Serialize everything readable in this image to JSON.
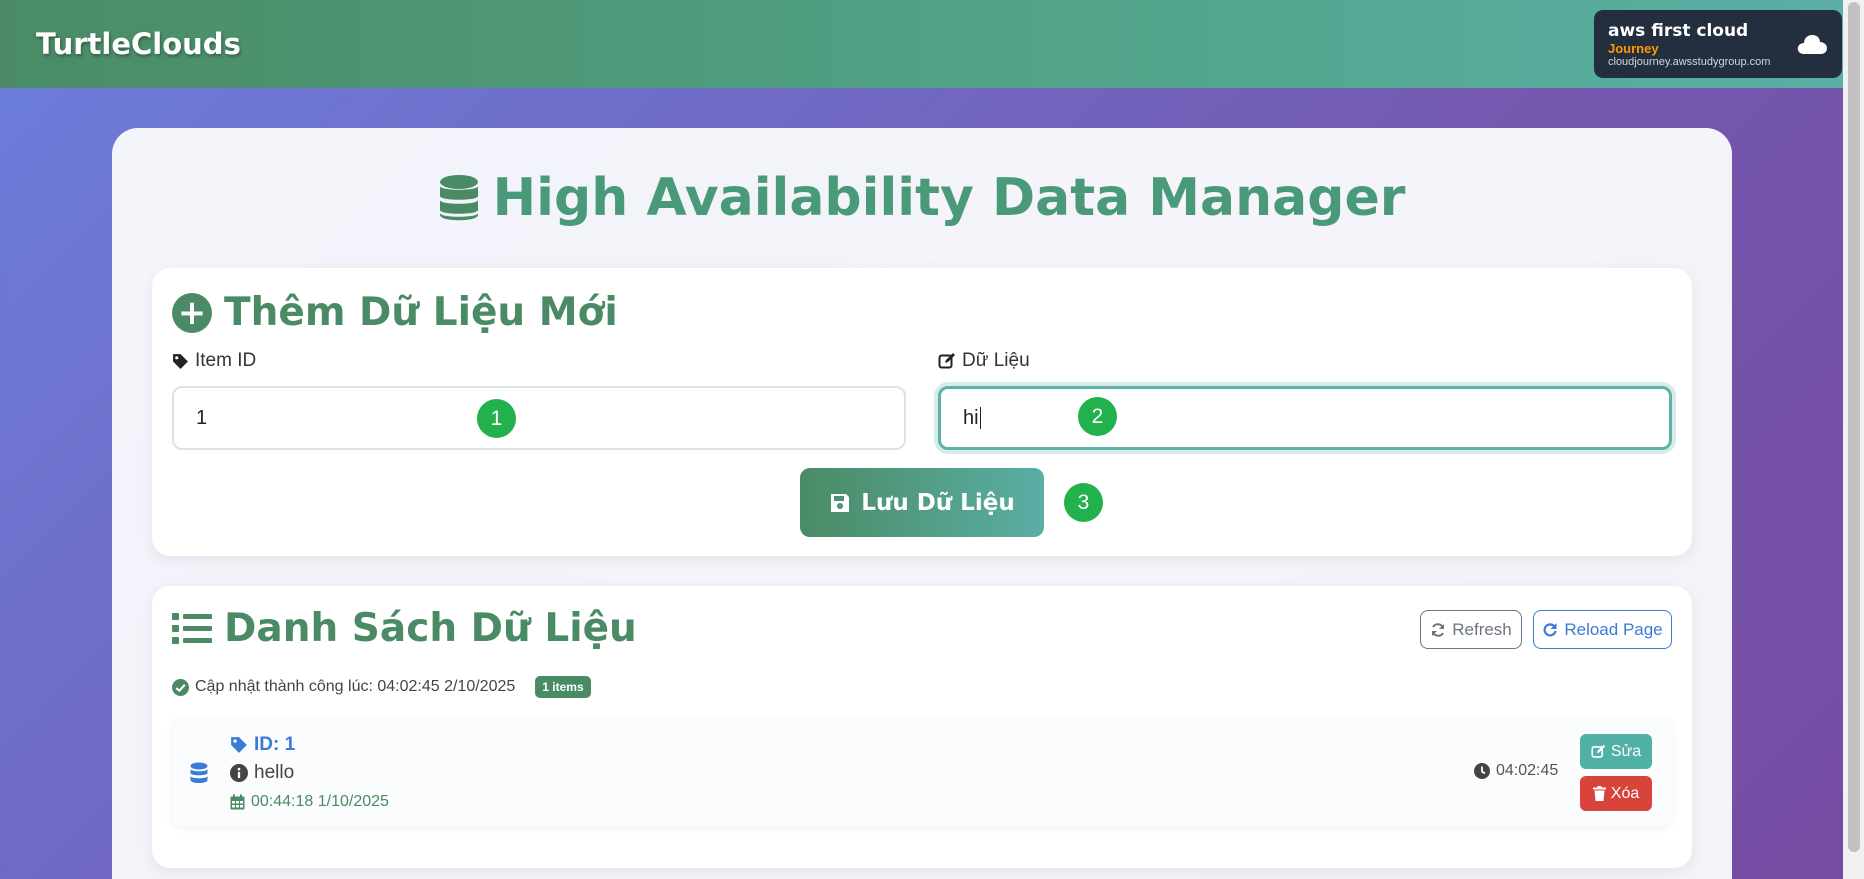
{
  "navbar": {
    "brand": "TurtleClouds",
    "badge": {
      "title": "aws first cloud",
      "subtitle": "Journey",
      "url": "cloudjourney.awsstudygroup.com",
      "icon": "cloud-icon"
    }
  },
  "page": {
    "title": "High Availability Data Manager",
    "title_icon": "database-icon"
  },
  "add_section": {
    "title": "Thêm Dữ Liệu Mới",
    "item_id_label": "Item ID",
    "item_id_value": "1",
    "data_label": "Dữ Liệu",
    "data_value": "hi",
    "save_label": "Lưu Dữ Liệu"
  },
  "annotations": [
    "1",
    "2",
    "3"
  ],
  "list_section": {
    "title": "Danh Sách Dữ Liệu",
    "refresh_label": "Refresh",
    "reload_label": "Reload Page",
    "status_text": "Cập nhật thành công lúc: 04:02:45 2/10/2025",
    "count_badge": "1 items",
    "items": [
      {
        "id": "ID: 1",
        "value": "hello",
        "created": "00:44:18 1/10/2025",
        "time": "04:02:45",
        "edit_label": "Sửa",
        "delete_label": "Xóa"
      }
    ]
  },
  "colors": {
    "brand_green": "#4a8b65",
    "teal": "#52b1a5",
    "blue": "#3a7bd5",
    "danger": "#d9443a",
    "step_green": "#22b14c",
    "aws_orange": "#ff9900"
  }
}
